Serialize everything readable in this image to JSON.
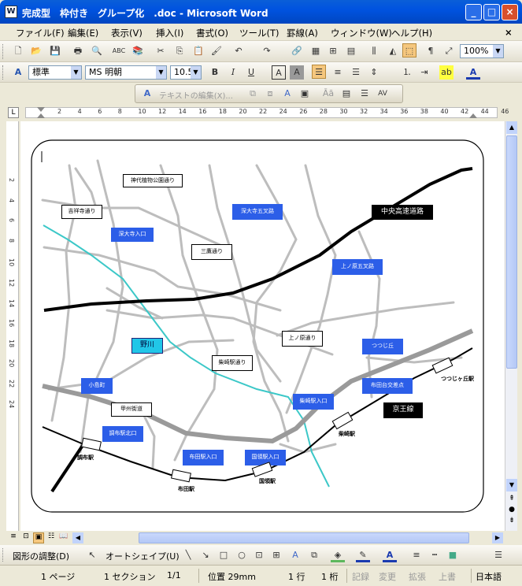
{
  "window": {
    "title": "完成型　枠付き　グループ化　.doc - Microsoft Word",
    "app_icon": "W"
  },
  "menus": [
    "ファイル(F)",
    "編集(E)",
    "表示(V)",
    "挿入(I)",
    "書式(O)",
    "ツール(T)",
    "罫線(A)",
    "ウィンドウ(W)",
    "ヘルプ(H)"
  ],
  "toolbar": {
    "zoom": "100%"
  },
  "format": {
    "style": "標準",
    "font": "MS 明朝",
    "size": "10.5"
  },
  "textbox_toolbar": {
    "label": "テキストの編集(X)..."
  },
  "ruler": {
    "ticks": [
      "2",
      "4",
      "6",
      "8",
      "10",
      "12",
      "14",
      "16",
      "18",
      "20",
      "22",
      "24",
      "26",
      "28",
      "30",
      "32",
      "34",
      "36",
      "38",
      "40",
      "42",
      "44",
      "46"
    ],
    "vticks": [
      "2",
      "4",
      "6",
      "8",
      "10",
      "12",
      "14",
      "16",
      "18",
      "20",
      "22",
      "24"
    ]
  },
  "map": {
    "labels": [
      {
        "id": "jindaiji",
        "text": "神代植物公園通り",
        "style": "w"
      },
      {
        "id": "kichijoji",
        "text": "吉祥寺通り",
        "style": "w"
      },
      {
        "id": "jindai-gochome",
        "text": "深大寺五叉路",
        "style": "b"
      },
      {
        "id": "chuo",
        "text": "中央高速道路",
        "style": "k"
      },
      {
        "id": "jindai-iriguchi",
        "text": "深大寺入口",
        "style": "b"
      },
      {
        "id": "mitaka",
        "text": "三鷹通り",
        "style": "w"
      },
      {
        "id": "kaminohara-gochome",
        "text": "上ノ原五叉路",
        "style": "b"
      },
      {
        "id": "nogawa",
        "text": "野川",
        "style": "c"
      },
      {
        "id": "kaminohara",
        "text": "上ノ原通り",
        "style": "w"
      },
      {
        "id": "tsutsujigaoka",
        "text": "つつじ丘",
        "style": "b"
      },
      {
        "id": "shibasaki",
        "text": "柴崎駅通り",
        "style": "w"
      },
      {
        "id": "kojima",
        "text": "小島町",
        "style": "b"
      },
      {
        "id": "kokuryo-iriguchi",
        "text": "柴崎駅入口",
        "style": "b"
      },
      {
        "id": "kamikyo",
        "text": "布田台交差点",
        "style": "b"
      },
      {
        "id": "koshu",
        "text": "甲州街道",
        "style": "w"
      },
      {
        "id": "keio",
        "text": "京王線",
        "style": "k"
      },
      {
        "id": "chofu-kita",
        "text": "調布駅北口",
        "style": "b"
      },
      {
        "id": "fuda-iriguchi",
        "text": "布田駅入口",
        "style": "b"
      },
      {
        "id": "kokuryo-eki-iriguchi",
        "text": "国領駅入口",
        "style": "b"
      }
    ],
    "stations": [
      {
        "id": "chofu",
        "text": "調布駅"
      },
      {
        "id": "fuda",
        "text": "布田駅"
      },
      {
        "id": "kokuryo",
        "text": "国領駅"
      },
      {
        "id": "shibasaki-st",
        "text": "柴崎駅"
      },
      {
        "id": "tsutsujigaoka-st",
        "text": "つつじヶ丘駅"
      }
    ]
  },
  "drawing": {
    "adjust": "図形の調整(D)",
    "autoshape": "オートシェイプ(U)"
  },
  "status": {
    "page": "1 ページ",
    "section": "1 セクション",
    "pages": "1/1",
    "position": "位置 29mm",
    "line": "1 行",
    "col": "1 桁",
    "rec": "記録",
    "trk": "変更",
    "ext": "拡張",
    "ovr": "上書",
    "lang": "日本語"
  }
}
